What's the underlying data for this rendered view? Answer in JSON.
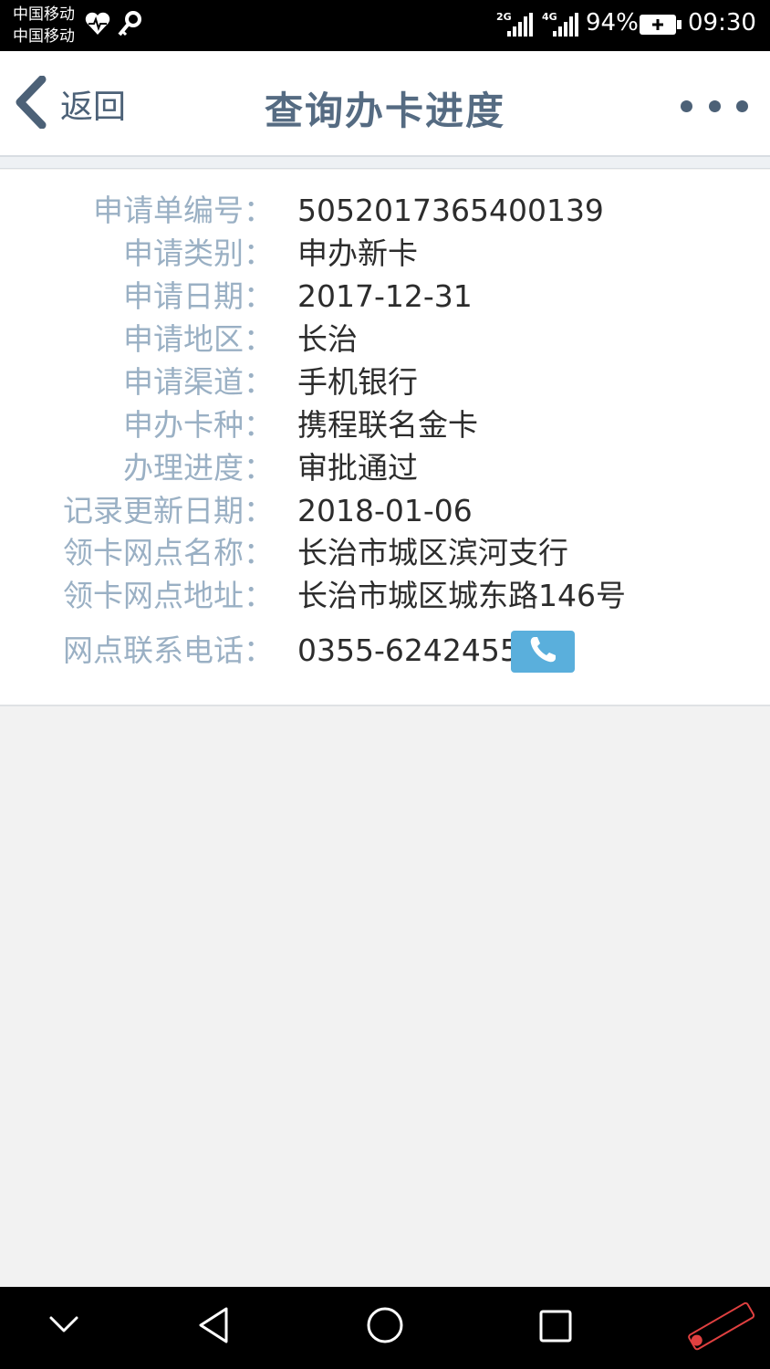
{
  "status_bar": {
    "carrier_1": "中国移动",
    "carrier_2": "中国移动",
    "net_1": "2G",
    "net_2": "4G",
    "battery": "94%",
    "time": "09:30"
  },
  "nav": {
    "back_label": "返回",
    "title": "查询办卡进度"
  },
  "details": [
    {
      "label": "申请单编号：",
      "value": "5052017365400139"
    },
    {
      "label": "申请类别：",
      "value": "申办新卡"
    },
    {
      "label": "申请日期：",
      "value": "2017-12-31"
    },
    {
      "label": "申请地区：",
      "value": "长治"
    },
    {
      "label": "申请渠道：",
      "value": "手机银行"
    },
    {
      "label": "申办卡种：",
      "value": "携程联名金卡"
    },
    {
      "label": "办理进度：",
      "value": "审批通过"
    },
    {
      "label": "记录更新日期：",
      "value": "2018-01-06"
    },
    {
      "label": "领卡网点名称：",
      "value": "长治市城区滨河支行"
    },
    {
      "label": "领卡网点地址：",
      "value": "长治市城区城东路146号"
    },
    {
      "label": "网点联系电话：",
      "value": "0355-6242455"
    }
  ],
  "colors": {
    "accent": "#556b82",
    "label": "#9ab0c4",
    "call_button": "#5aafdc"
  },
  "icons": {
    "back": "chevron-left-icon",
    "more": "more-dots-icon",
    "call": "phone-icon",
    "android_down": "chevron-down-icon",
    "android_back": "triangle-back-icon",
    "android_home": "circle-home-icon",
    "android_recent": "square-recent-icon"
  }
}
